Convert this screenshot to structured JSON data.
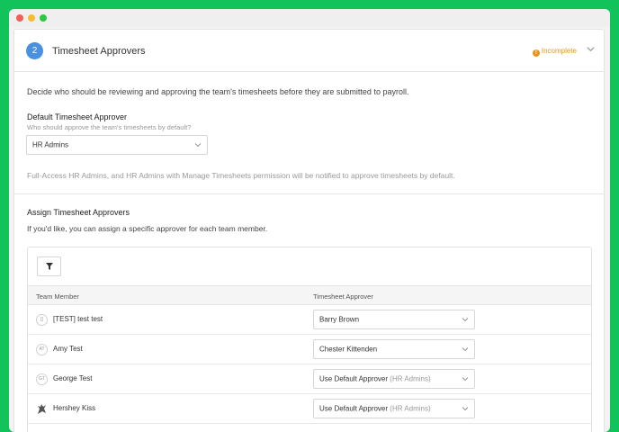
{
  "section": {
    "step": "2",
    "title": "Timesheet Approvers",
    "status": "Incomplete",
    "intro": "Decide who should be reviewing and approving the team's timesheets before they are submitted to payroll."
  },
  "default_approver": {
    "label": "Default Timesheet Approver",
    "sublabel": "Who should approve the team's timesheets by default?",
    "value": "HR Admins",
    "note": "Full-Access HR Admins, and HR Admins with Manage Timesheets permission will be notified to approve timesheets by default."
  },
  "assign": {
    "title": "Assign Timesheet Approvers",
    "subtitle": "If you'd like, you can assign a specific approver for each team member."
  },
  "table": {
    "col_member": "Team Member",
    "col_approver": "Timesheet Approver",
    "rows": [
      {
        "initials": "[]",
        "name": "[TEST] test test",
        "approver": "Barry Brown",
        "approver_muted": ""
      },
      {
        "initials": "AT",
        "name": "Amy Test",
        "approver": "Chester Kittenden",
        "approver_muted": ""
      },
      {
        "initials": "GT",
        "name": "George Test",
        "approver": "Use Default Approver",
        "approver_muted": "(HR Admins)"
      },
      {
        "initials": "",
        "name": "Hershey Kiss",
        "approver": "Use Default Approver",
        "approver_muted": "(HR Admins)"
      }
    ]
  },
  "colors": {
    "accent": "#4a90e2",
    "warning": "#e8951d",
    "background": "#12c25a"
  }
}
